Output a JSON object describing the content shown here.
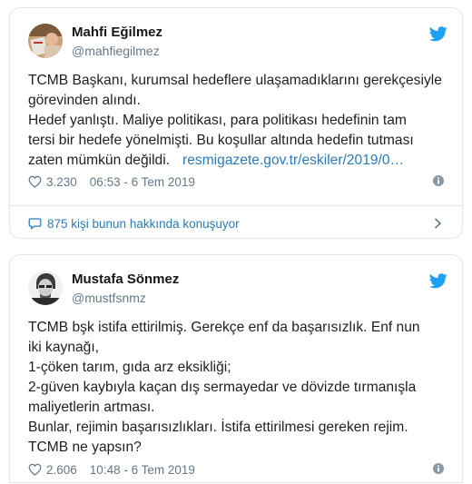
{
  "tweets": [
    {
      "author_name": "Mahfi Eğilmez",
      "author_handle": "@mahfiegilmez",
      "avatar_icon": "mahfi-avatar-photo",
      "text_lines": [
        "TCMB Başkanı, kurumsal hedeflere ulaşamadıklarını gerekçesiyle",
        "görevinden alındı.",
        "Hedef yanlıştı. Maliye politikası, para politikası hedefinin tam",
        "tersi bir hedefe yönelmişti. Bu koşullar altında hedefin tutması",
        "zaten mümkün değildi."
      ],
      "link_text": "resmigazete.gov.tr/eskiler/2019/0…",
      "likes": "3.230",
      "timestamp": "06:53 - 6 Tem 2019",
      "conversation": "875 kişi bunun hakkında konuşuyor"
    },
    {
      "author_name": "Mustafa Sönmez",
      "author_handle": "@mustfsnmz",
      "avatar_icon": "mustafa-avatar-photo",
      "text_lines": [
        "TCMB bşk istifa ettirilmiş. Gerekçe enf da başarısızlık. Enf nun",
        "iki kaynağı,",
        "1-çöken tarım, gıda arz eksikliği;",
        "2-güven kaybıyla kaçan dış sermayedar ve dövizde tırmanışla",
        "maliyetlerin artması.",
        "Bunlar, rejimin başarısızlıkları. İstifa ettirilmesi gereken rejim.",
        "TCMB ne yapsın?"
      ],
      "likes": "2.606",
      "timestamp": "10:48 - 6 Tem 2019"
    }
  ],
  "colors": {
    "twitter_blue": "#1da1f2",
    "link_blue": "#2b7bb9",
    "meta_gray": "#657786",
    "border": "#e1e8ed"
  }
}
